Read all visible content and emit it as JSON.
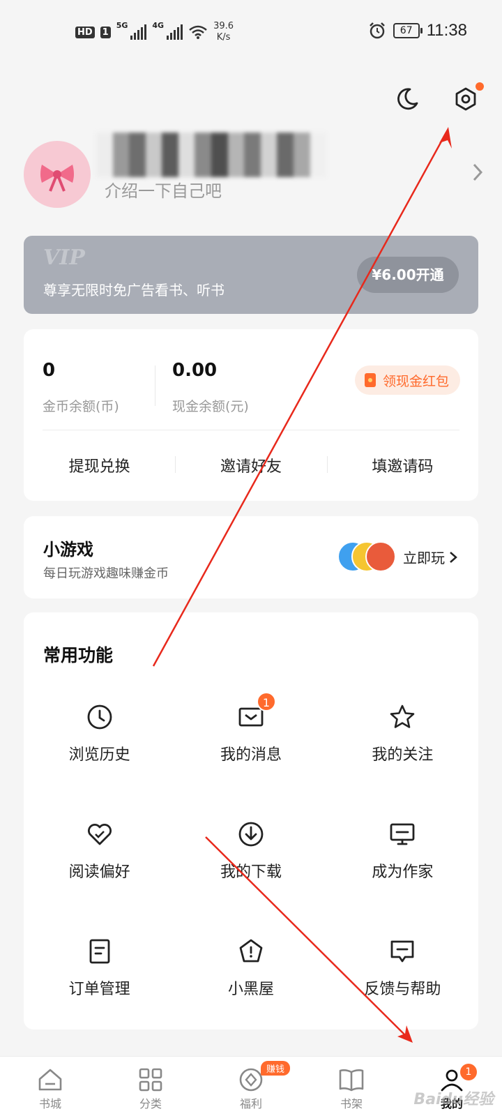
{
  "status_bar": {
    "hd": "HD",
    "sim": "1",
    "net1": "5G",
    "net2": "4G",
    "speed_value": "39.6",
    "speed_unit": "K/s",
    "battery": "67",
    "time": "11:38"
  },
  "top_icons": [
    "moon-icon",
    "settings-icon"
  ],
  "profile": {
    "bio": "介绍一下自己吧"
  },
  "vip": {
    "logo": "VIP",
    "desc": "尊享无限时免广告看书、听书",
    "button": "¥6.00开通"
  },
  "wallet": {
    "coins": "0",
    "coins_label": "金币余额(币)",
    "cash": "0.00",
    "cash_label": "现金余额(元)",
    "red_packet": "领现金红包",
    "actions": [
      "提现兑换",
      "邀请好友",
      "填邀请码"
    ]
  },
  "games": {
    "title": "小游戏",
    "subtitle": "每日玩游戏趣味赚金币",
    "play": "立即玩"
  },
  "features": {
    "title": "常用功能",
    "items": [
      {
        "label": "浏览历史",
        "icon": "clock-icon"
      },
      {
        "label": "我的消息",
        "icon": "message-icon",
        "badge": "1"
      },
      {
        "label": "我的关注",
        "icon": "star-icon"
      },
      {
        "label": "阅读偏好",
        "icon": "heart-icon"
      },
      {
        "label": "我的下载",
        "icon": "download-icon"
      },
      {
        "label": "成为作家",
        "icon": "monitor-icon"
      },
      {
        "label": "订单管理",
        "icon": "document-icon"
      },
      {
        "label": "小黑屋",
        "icon": "house-icon"
      },
      {
        "label": "反馈与帮助",
        "icon": "feedback-icon"
      }
    ]
  },
  "tabbar": {
    "tabs": [
      {
        "label": "书城",
        "icon": "bookstore-icon"
      },
      {
        "label": "分类",
        "icon": "category-icon"
      },
      {
        "label": "福利",
        "icon": "welfare-icon",
        "tag": "赚钱"
      },
      {
        "label": "书架",
        "icon": "bookshelf-icon"
      },
      {
        "label": "我的",
        "icon": "profile-icon",
        "badge": "1",
        "active": true
      }
    ]
  },
  "colors": {
    "accent": "#ff6a2c",
    "vip_bg": "#a9adb6",
    "annotation_arrow": "#e8291c"
  },
  "watermark": "Baidu经验"
}
